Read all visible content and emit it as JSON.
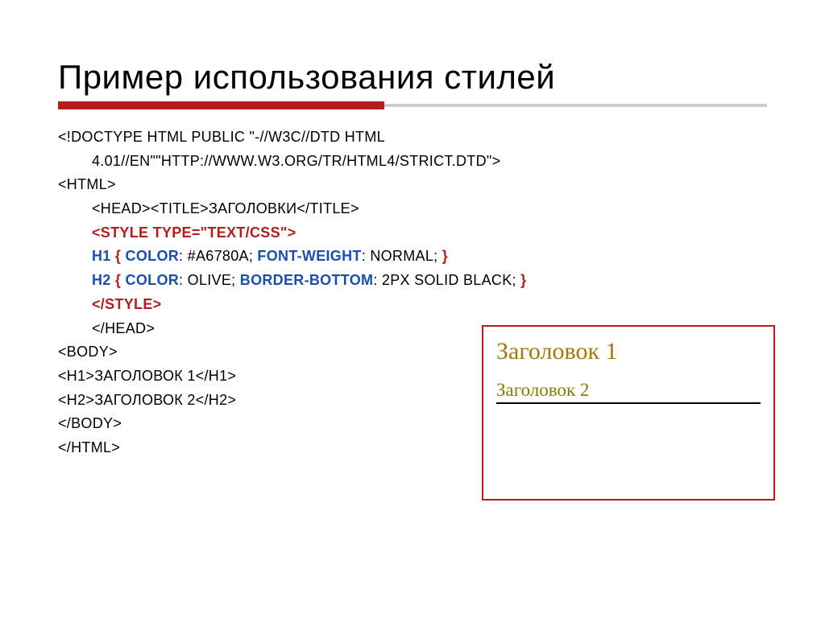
{
  "title": "Пример использования стилей",
  "code": {
    "l1": "<!DOCTYPE HTML PUBLIC \"-//W3C//DTD HTML",
    "l2": "4.01//EN\"\"http://www.w3.org/TR/html4/strict.dtd\">",
    "l3": "<HTML>",
    "l4": "<HEAD><TITLE>Заголовки</TITLE>",
    "l5": "<STYLE TYPE=\"TEXT/CSS\">",
    "l6_h1": "H1",
    "l6_open": " { ",
    "l6_prop1": "COLOR",
    "l6_sep1": ": #A6780A; ",
    "l6_prop2": "FONT-WEIGHT",
    "l6_sep2": ": normal; ",
    "l6_close": "}",
    "l7_h2": "H2",
    "l7_open": " { ",
    "l7_prop1": "COLOR",
    "l7_sep1": ": olive; ",
    "l7_prop2": "BORDER-BOTTOM",
    "l7_sep2": ": 2px solid black; ",
    "l7_close": "}",
    "l8": "</STYLE>",
    "l9": "</HEAD>",
    "l10": "<BODY>",
    "l11": "<H1>Заголовок 1</H1>",
    "l12": "<H2>Заголовок 2</H2>",
    "l13": "</BODY>",
    "l14": "</HTML>"
  },
  "preview": {
    "h1": "Заголовок 1",
    "h2": "Заголовок 2"
  }
}
